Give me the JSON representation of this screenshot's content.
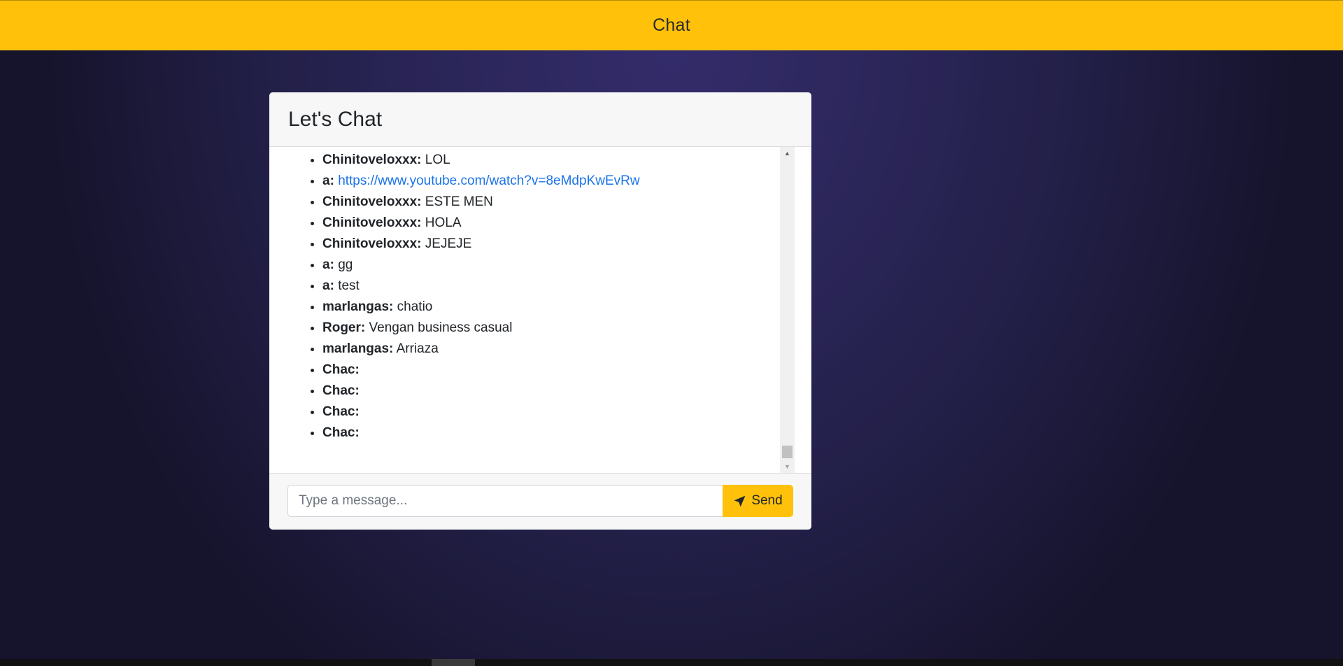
{
  "navbar": {
    "title": "Chat"
  },
  "chat": {
    "title": "Let's Chat",
    "messages": [
      {
        "user": "Chinitoveloxxx:",
        "text": "LOL",
        "is_link": false
      },
      {
        "user": "a:",
        "text": "https://www.youtube.com/watch?v=8eMdpKwEvRw",
        "is_link": true
      },
      {
        "user": "Chinitoveloxxx:",
        "text": "ESTE MEN",
        "is_link": false
      },
      {
        "user": "Chinitoveloxxx:",
        "text": "HOLA",
        "is_link": false
      },
      {
        "user": "Chinitoveloxxx:",
        "text": "JEJEJE",
        "is_link": false
      },
      {
        "user": "a:",
        "text": "gg",
        "is_link": false
      },
      {
        "user": "a:",
        "text": "test",
        "is_link": false
      },
      {
        "user": "marlangas:",
        "text": "chatio",
        "is_link": false
      },
      {
        "user": "Roger:",
        "text": "Vengan business casual",
        "is_link": false
      },
      {
        "user": "marlangas:",
        "text": "Arriaza",
        "is_link": false
      },
      {
        "user": "Chac:",
        "text": "",
        "is_link": false
      },
      {
        "user": "Chac:",
        "text": "",
        "is_link": false
      },
      {
        "user": "Chac:",
        "text": "",
        "is_link": false
      },
      {
        "user": "Chac:",
        "text": "",
        "is_link": false
      }
    ],
    "input": {
      "placeholder": "Type a message...",
      "value": ""
    },
    "send_button": {
      "label": "Send",
      "icon": "paper-plane-icon"
    }
  },
  "colors": {
    "accent": "#ffc10a",
    "link": "#1a73e8",
    "background": "#2b2659"
  }
}
